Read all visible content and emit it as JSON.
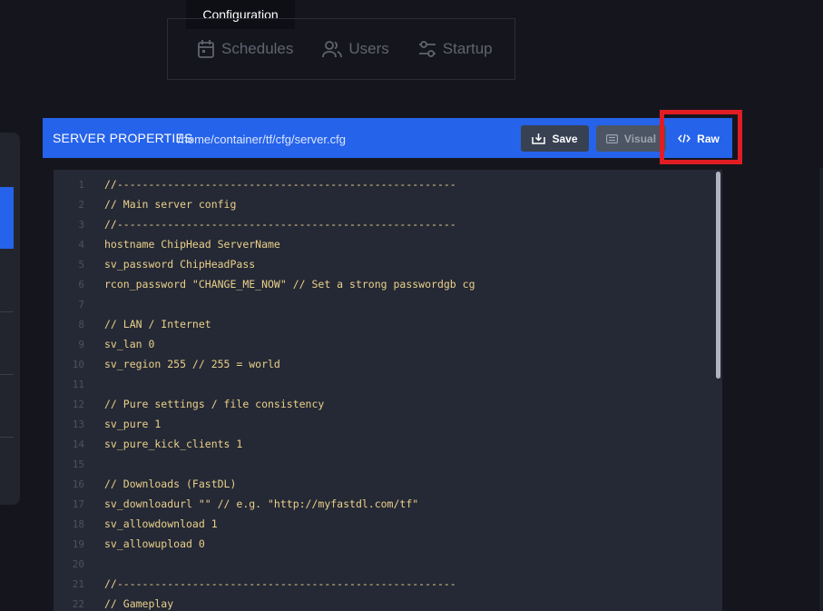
{
  "tooltip": "Configuration",
  "tabs": [
    {
      "label": "Schedules",
      "icon": "calendar-icon"
    },
    {
      "label": "Users",
      "icon": "users-icon"
    },
    {
      "label": "Startup",
      "icon": "sliders-icon"
    }
  ],
  "panel": {
    "title": "SERVER PROPERTIES",
    "path": "/home/container/tf/cfg/server.cfg",
    "save_label": "Save",
    "visual_label": "Visual",
    "raw_label": "Raw"
  },
  "colors": {
    "accent": "#2563eb",
    "highlight": "#e11d24",
    "code_text": "#ead08a"
  },
  "editor": {
    "lines": [
      {
        "n": "1",
        "text": "//------------------------------------------------------"
      },
      {
        "n": "2",
        "text": "// Main server config"
      },
      {
        "n": "3",
        "text": "//------------------------------------------------------"
      },
      {
        "n": "4",
        "text": "hostname ChipHead ServerName"
      },
      {
        "n": "5",
        "text": "sv_password ChipHeadPass"
      },
      {
        "n": "6",
        "text": "rcon_password \"CHANGE_ME_NOW\" // Set a strong passwordgb cg"
      },
      {
        "n": "7",
        "text": ""
      },
      {
        "n": "8",
        "text": "// LAN / Internet"
      },
      {
        "n": "9",
        "text": "sv_lan 0"
      },
      {
        "n": "10",
        "text": "sv_region 255 // 255 = world"
      },
      {
        "n": "11",
        "text": ""
      },
      {
        "n": "12",
        "text": "// Pure settings / file consistency"
      },
      {
        "n": "13",
        "text": "sv_pure 1"
      },
      {
        "n": "14",
        "text": "sv_pure_kick_clients 1"
      },
      {
        "n": "15",
        "text": ""
      },
      {
        "n": "16",
        "text": "// Downloads (FastDL)"
      },
      {
        "n": "17",
        "text": "sv_downloadurl \"\" // e.g. \"http://myfastdl.com/tf\""
      },
      {
        "n": "18",
        "text": "sv_allowdownload 1"
      },
      {
        "n": "19",
        "text": "sv_allowupload 0"
      },
      {
        "n": "20",
        "text": ""
      },
      {
        "n": "21",
        "text": "//------------------------------------------------------"
      },
      {
        "n": "22",
        "text": "// Gameplay"
      }
    ]
  }
}
